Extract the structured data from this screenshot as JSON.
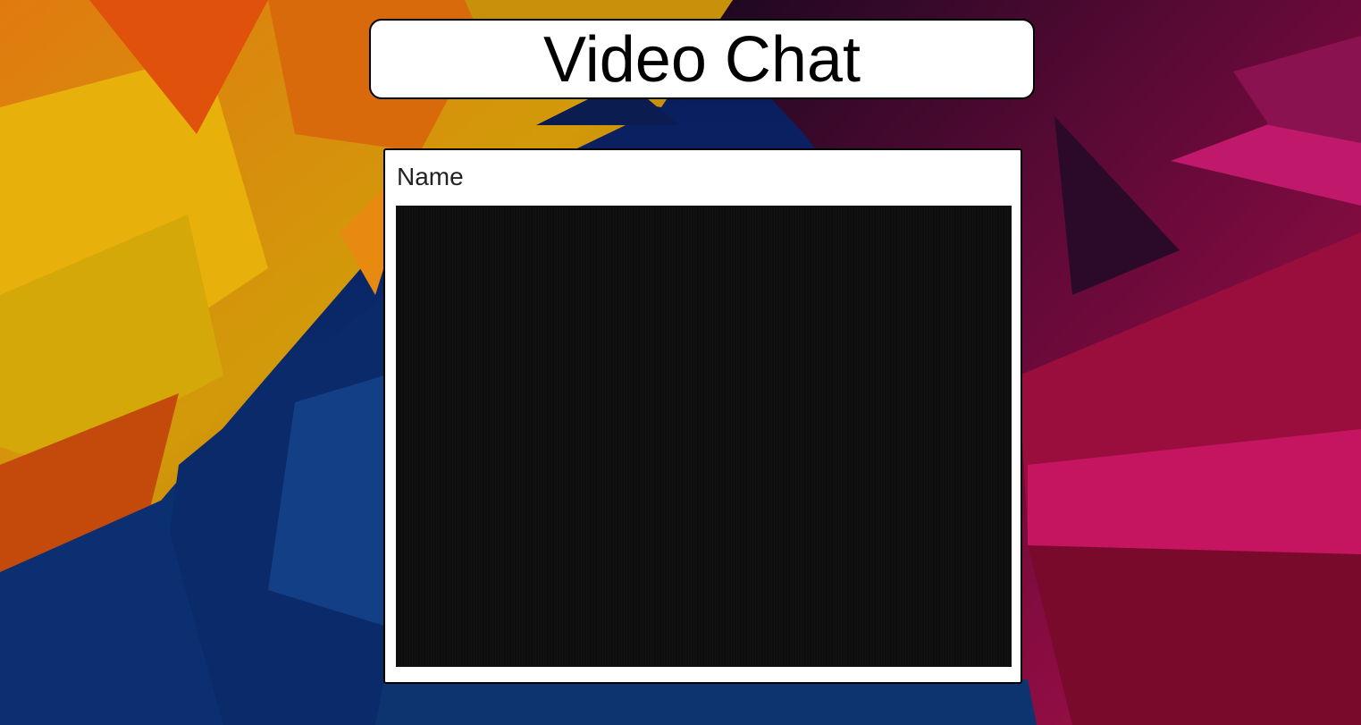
{
  "header": {
    "title": "Video Chat"
  },
  "video_tile": {
    "participant_name": "Name"
  },
  "colors": {
    "card_background": "#ffffff",
    "card_border": "#000000",
    "video_background": "#0e0e0e",
    "text": "#000000"
  },
  "background": {
    "description_icon": "abstract-polygon-wallpaper"
  }
}
